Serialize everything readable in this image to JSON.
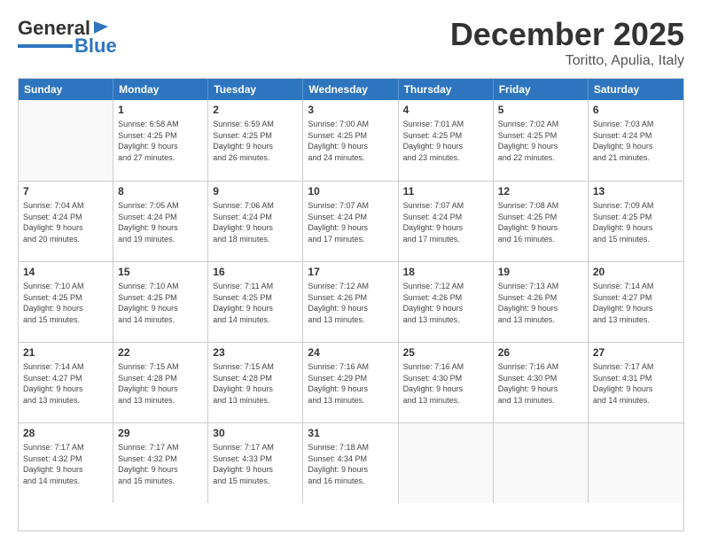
{
  "header": {
    "logo_line1": "General",
    "logo_line2": "Blue",
    "month": "December 2025",
    "location": "Toritto, Apulia, Italy"
  },
  "weekdays": [
    "Sunday",
    "Monday",
    "Tuesday",
    "Wednesday",
    "Thursday",
    "Friday",
    "Saturday"
  ],
  "weeks": [
    [
      {
        "day": "",
        "info": ""
      },
      {
        "day": "1",
        "info": "Sunrise: 6:58 AM\nSunset: 4:25 PM\nDaylight: 9 hours\nand 27 minutes."
      },
      {
        "day": "2",
        "info": "Sunrise: 6:59 AM\nSunset: 4:25 PM\nDaylight: 9 hours\nand 26 minutes."
      },
      {
        "day": "3",
        "info": "Sunrise: 7:00 AM\nSunset: 4:25 PM\nDaylight: 9 hours\nand 24 minutes."
      },
      {
        "day": "4",
        "info": "Sunrise: 7:01 AM\nSunset: 4:25 PM\nDaylight: 9 hours\nand 23 minutes."
      },
      {
        "day": "5",
        "info": "Sunrise: 7:02 AM\nSunset: 4:25 PM\nDaylight: 9 hours\nand 22 minutes."
      },
      {
        "day": "6",
        "info": "Sunrise: 7:03 AM\nSunset: 4:24 PM\nDaylight: 9 hours\nand 21 minutes."
      }
    ],
    [
      {
        "day": "7",
        "info": "Sunrise: 7:04 AM\nSunset: 4:24 PM\nDaylight: 9 hours\nand 20 minutes."
      },
      {
        "day": "8",
        "info": "Sunrise: 7:05 AM\nSunset: 4:24 PM\nDaylight: 9 hours\nand 19 minutes."
      },
      {
        "day": "9",
        "info": "Sunrise: 7:06 AM\nSunset: 4:24 PM\nDaylight: 9 hours\nand 18 minutes."
      },
      {
        "day": "10",
        "info": "Sunrise: 7:07 AM\nSunset: 4:24 PM\nDaylight: 9 hours\nand 17 minutes."
      },
      {
        "day": "11",
        "info": "Sunrise: 7:07 AM\nSunset: 4:24 PM\nDaylight: 9 hours\nand 17 minutes."
      },
      {
        "day": "12",
        "info": "Sunrise: 7:08 AM\nSunset: 4:25 PM\nDaylight: 9 hours\nand 16 minutes."
      },
      {
        "day": "13",
        "info": "Sunrise: 7:09 AM\nSunset: 4:25 PM\nDaylight: 9 hours\nand 15 minutes."
      }
    ],
    [
      {
        "day": "14",
        "info": "Sunrise: 7:10 AM\nSunset: 4:25 PM\nDaylight: 9 hours\nand 15 minutes."
      },
      {
        "day": "15",
        "info": "Sunrise: 7:10 AM\nSunset: 4:25 PM\nDaylight: 9 hours\nand 14 minutes."
      },
      {
        "day": "16",
        "info": "Sunrise: 7:11 AM\nSunset: 4:25 PM\nDaylight: 9 hours\nand 14 minutes."
      },
      {
        "day": "17",
        "info": "Sunrise: 7:12 AM\nSunset: 4:26 PM\nDaylight: 9 hours\nand 13 minutes."
      },
      {
        "day": "18",
        "info": "Sunrise: 7:12 AM\nSunset: 4:26 PM\nDaylight: 9 hours\nand 13 minutes."
      },
      {
        "day": "19",
        "info": "Sunrise: 7:13 AM\nSunset: 4:26 PM\nDaylight: 9 hours\nand 13 minutes."
      },
      {
        "day": "20",
        "info": "Sunrise: 7:14 AM\nSunset: 4:27 PM\nDaylight: 9 hours\nand 13 minutes."
      }
    ],
    [
      {
        "day": "21",
        "info": "Sunrise: 7:14 AM\nSunset: 4:27 PM\nDaylight: 9 hours\nand 13 minutes."
      },
      {
        "day": "22",
        "info": "Sunrise: 7:15 AM\nSunset: 4:28 PM\nDaylight: 9 hours\nand 13 minutes."
      },
      {
        "day": "23",
        "info": "Sunrise: 7:15 AM\nSunset: 4:28 PM\nDaylight: 9 hours\nand 13 minutes."
      },
      {
        "day": "24",
        "info": "Sunrise: 7:16 AM\nSunset: 4:29 PM\nDaylight: 9 hours\nand 13 minutes."
      },
      {
        "day": "25",
        "info": "Sunrise: 7:16 AM\nSunset: 4:30 PM\nDaylight: 9 hours\nand 13 minutes."
      },
      {
        "day": "26",
        "info": "Sunrise: 7:16 AM\nSunset: 4:30 PM\nDaylight: 9 hours\nand 13 minutes."
      },
      {
        "day": "27",
        "info": "Sunrise: 7:17 AM\nSunset: 4:31 PM\nDaylight: 9 hours\nand 14 minutes."
      }
    ],
    [
      {
        "day": "28",
        "info": "Sunrise: 7:17 AM\nSunset: 4:32 PM\nDaylight: 9 hours\nand 14 minutes."
      },
      {
        "day": "29",
        "info": "Sunrise: 7:17 AM\nSunset: 4:32 PM\nDaylight: 9 hours\nand 15 minutes."
      },
      {
        "day": "30",
        "info": "Sunrise: 7:17 AM\nSunset: 4:33 PM\nDaylight: 9 hours\nand 15 minutes."
      },
      {
        "day": "31",
        "info": "Sunrise: 7:18 AM\nSunset: 4:34 PM\nDaylight: 9 hours\nand 16 minutes."
      },
      {
        "day": "",
        "info": ""
      },
      {
        "day": "",
        "info": ""
      },
      {
        "day": "",
        "info": ""
      }
    ]
  ]
}
